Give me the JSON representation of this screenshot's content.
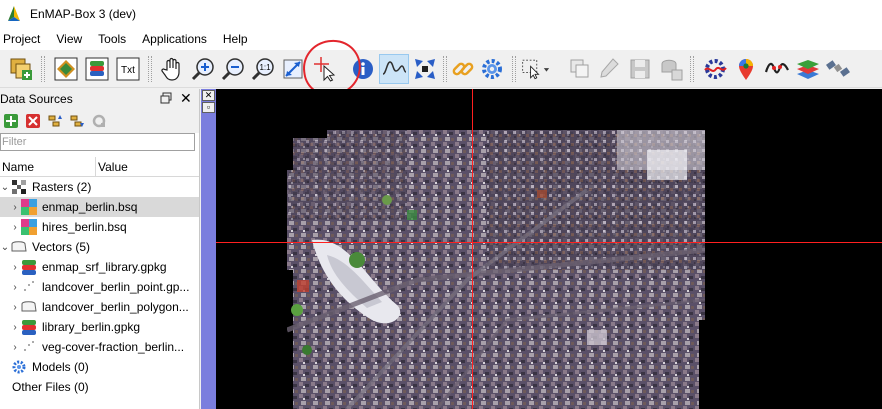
{
  "window": {
    "title": "EnMAP-Box 3 (dev)",
    "app_icon": "enmap-logo-icon"
  },
  "menubar": {
    "items": [
      "Project",
      "View",
      "Tools",
      "Applications",
      "Help"
    ]
  },
  "toolbar": {
    "buttons": [
      {
        "name": "add-data-source-button",
        "icon": "add-data-icon"
      },
      {
        "name": "open-map-view-button",
        "icon": "map-view-icon"
      },
      {
        "name": "open-spectral-library-button",
        "icon": "spectral-library-icon"
      },
      {
        "name": "open-text-view-button",
        "icon": "text-view-icon",
        "label": "Txt"
      },
      {
        "name": "pan-button",
        "icon": "pan-hand-icon"
      },
      {
        "name": "zoom-in-button",
        "icon": "zoom-in-icon"
      },
      {
        "name": "zoom-out-button",
        "icon": "zoom-out-icon"
      },
      {
        "name": "zoom-pixel-scale-button",
        "icon": "zoom-1-1-icon",
        "label": "1:1"
      },
      {
        "name": "zoom-full-extent-button",
        "icon": "zoom-full-icon"
      },
      {
        "name": "select-map-location-button",
        "icon": "crosshair-cursor-icon"
      },
      {
        "name": "identify-button",
        "icon": "info-icon"
      },
      {
        "name": "identify-profile-button",
        "icon": "profile-icon",
        "active": true
      },
      {
        "name": "center-map-button",
        "icon": "center-arrows-icon"
      },
      {
        "name": "link-maps-button",
        "icon": "link-icon"
      },
      {
        "name": "settings-button",
        "icon": "gear-icon"
      },
      {
        "name": "select-features-button",
        "icon": "select-rectangle-icon"
      },
      {
        "name": "deselect-features-button",
        "icon": "deselect-icon"
      },
      {
        "name": "edit-button",
        "icon": "pencil-icon"
      },
      {
        "name": "save-edits-button",
        "icon": "save-icon"
      },
      {
        "name": "add-feature-button",
        "icon": "add-feature-icon"
      },
      {
        "name": "processing-toolbox-button",
        "icon": "processing-gear-icon"
      },
      {
        "name": "location-button",
        "icon": "location-pin-icon"
      },
      {
        "name": "spectral-profile-button",
        "icon": "spectral-curve-icon"
      },
      {
        "name": "layers-button",
        "icon": "layers-icon"
      },
      {
        "name": "satellite-button",
        "icon": "satellite-icon"
      }
    ]
  },
  "data_sources": {
    "title": "Data Sources",
    "filter_placeholder": "Filter",
    "columns": [
      "Name",
      "Value"
    ],
    "tree": [
      {
        "label": "Rasters (2)",
        "icon": "raster-group-icon",
        "level": 0,
        "expanded": true
      },
      {
        "label": "enmap_berlin.bsq",
        "icon": "raster-layer-icon",
        "level": 1,
        "selected": true
      },
      {
        "label": "hires_berlin.bsq",
        "icon": "raster-layer-icon",
        "level": 1
      },
      {
        "label": "Vectors (5)",
        "icon": "vector-group-icon",
        "level": 0,
        "expanded": true
      },
      {
        "label": "enmap_srf_library.gpkg",
        "icon": "vector-library-icon",
        "level": 1
      },
      {
        "label": "landcover_berlin_point.gp...",
        "icon": "point-layer-icon",
        "level": 1
      },
      {
        "label": "landcover_berlin_polygon...",
        "icon": "polygon-layer-icon",
        "level": 1
      },
      {
        "label": "library_berlin.gpkg",
        "icon": "vector-library-icon",
        "level": 1
      },
      {
        "label": "veg-cover-fraction_berlin...",
        "icon": "point-layer-icon",
        "level": 1
      },
      {
        "label": "Models (0)",
        "icon": "model-gear-icon",
        "level": 0
      },
      {
        "label": "Other Files (0)",
        "icon": "",
        "level": 0
      }
    ]
  },
  "map_view": {
    "layer": "enmap_berlin.bsq",
    "crosshair_color": "#ff2020"
  },
  "colors": {
    "annotation_red": "#e3262d",
    "dock_strip": "#7b7ede",
    "selection": "#d9d9d9",
    "active_tool": "#cce4f7"
  }
}
